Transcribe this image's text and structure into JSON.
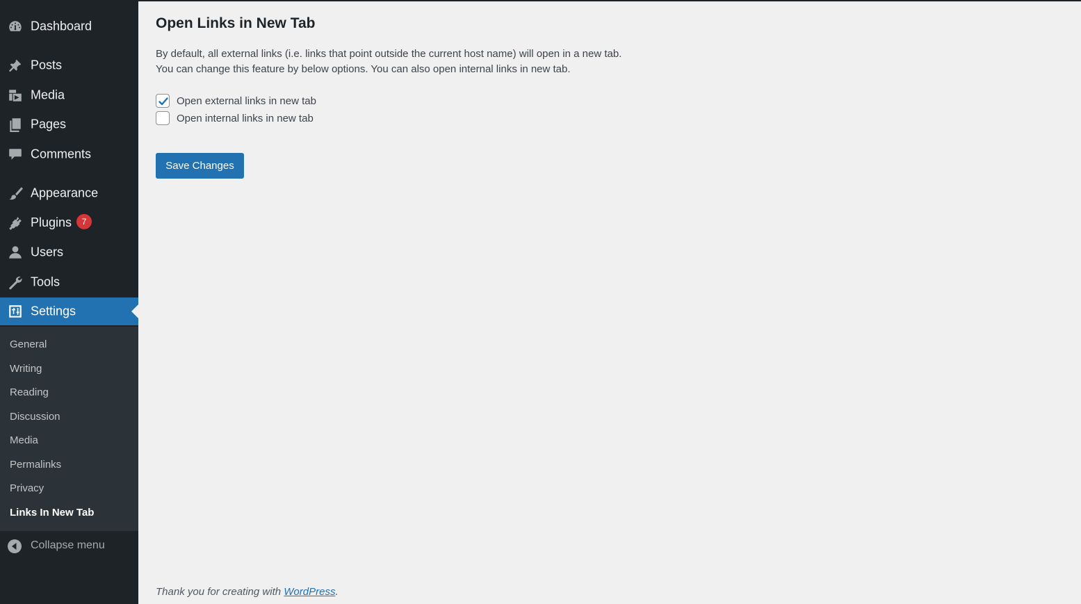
{
  "sidebar": {
    "items": [
      {
        "label": "Dashboard",
        "icon": "dashboard-icon"
      },
      {
        "label": "Posts",
        "icon": "pin-icon"
      },
      {
        "label": "Media",
        "icon": "media-icon"
      },
      {
        "label": "Pages",
        "icon": "pages-icon"
      },
      {
        "label": "Comments",
        "icon": "comment-icon"
      },
      {
        "label": "Appearance",
        "icon": "brush-icon"
      },
      {
        "label": "Plugins",
        "icon": "plugin-icon",
        "badge": "7"
      },
      {
        "label": "Users",
        "icon": "user-icon"
      },
      {
        "label": "Tools",
        "icon": "wrench-icon"
      },
      {
        "label": "Settings",
        "icon": "settings-icon",
        "current": true
      }
    ],
    "submenu": [
      {
        "label": "General"
      },
      {
        "label": "Writing"
      },
      {
        "label": "Reading"
      },
      {
        "label": "Discussion"
      },
      {
        "label": "Media"
      },
      {
        "label": "Permalinks"
      },
      {
        "label": "Privacy"
      },
      {
        "label": "Links In New Tab",
        "current": true
      }
    ],
    "collapse_label": "Collapse menu"
  },
  "main": {
    "title": "Open Links in New Tab",
    "description_line1": "By default, all external links (i.e. links that point outside the current host name) will open in a new tab.",
    "description_line2": "You can change this feature by below options. You can also open internal links in new tab.",
    "options": [
      {
        "label": "Open external links in new tab",
        "checked": true
      },
      {
        "label": "Open internal links in new tab",
        "checked": false
      }
    ],
    "save_label": "Save Changes"
  },
  "footer": {
    "text_before": "Thank you for creating with ",
    "link_text": "WordPress",
    "text_after": "."
  },
  "colors": {
    "sidebar_bg": "#1d2327",
    "submenu_bg": "#2c3338",
    "accent": "#2271b1",
    "badge": "#d63638",
    "page_bg": "#f0f0f1"
  }
}
